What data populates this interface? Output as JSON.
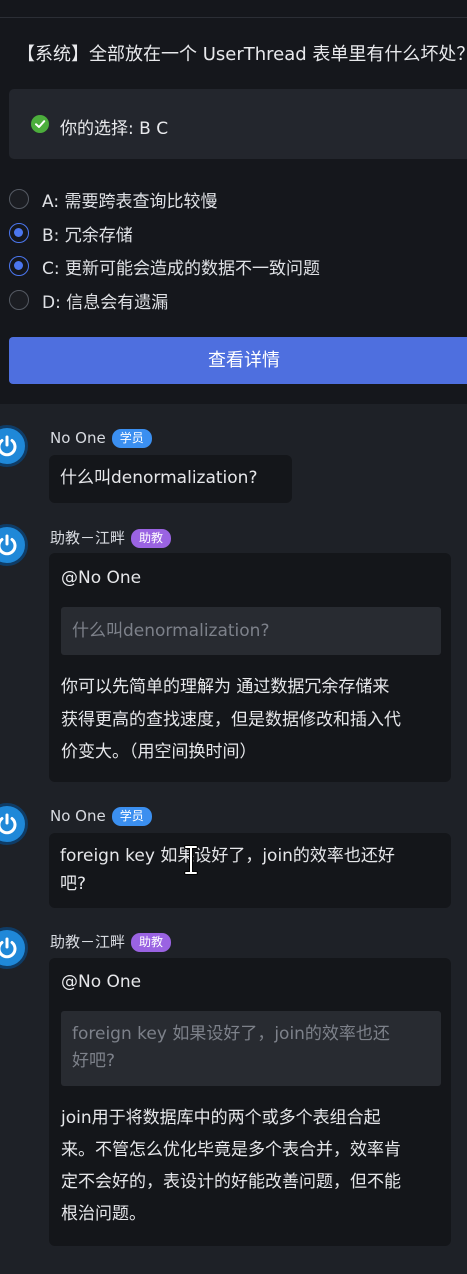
{
  "question": "【系统】全部放在一个 UserThread 表单里有什么坏处？",
  "your_choice": "你的选择: B   C",
  "options": [
    {
      "key": "A",
      "text": "A:  需要跨表查询比较慢",
      "selected": false
    },
    {
      "key": "B",
      "text": "B:  冗余存储",
      "selected": true
    },
    {
      "key": "C",
      "text": "C:  更新可能会造成的数据不一致问题",
      "selected": true
    },
    {
      "key": "D",
      "text": "D:  信息会有遗漏",
      "selected": false
    }
  ],
  "view_details_label": "查看详情",
  "comments": [
    {
      "author": "No One",
      "badge": "学员",
      "lines": [
        "什么叫denormalization?"
      ]
    },
    {
      "author": "助教－江畔",
      "badge": "助教",
      "mention": "@No One",
      "quote_lines": [
        "什么叫denormalization?"
      ],
      "lines": [
        "你可以先简单的理解为 通过数据冗余存储来",
        "获得更高的查找速度，但是数据修改和插入代",
        "价变大。（用空间换时间）"
      ]
    },
    {
      "author": "No One",
      "badge": "学员",
      "lines": [
        "foreign key 如果设好了，join的效率也还好",
        "吧?"
      ]
    },
    {
      "author": "助教－江畔",
      "badge": "助教",
      "mention": "@No One",
      "quote_lines": [
        "foreign key 如果设好了，join的效率也还",
        "好吧?"
      ],
      "lines": [
        "join用于将数据库中的两个或多个表组合起",
        "来。不管怎么优化毕竟是多个表合并，效率肯",
        "定不会好的，表设计的好能改善问题，但不能",
        "根治问题。"
      ]
    }
  ],
  "colors": {
    "accent": "#4e6fdf",
    "radio_selected": "#4b76ee",
    "check": "#4cae3c",
    "badge_student": "#3b8ff0",
    "badge_ta": "#9a63e2",
    "avatar": "#1f88d8"
  }
}
